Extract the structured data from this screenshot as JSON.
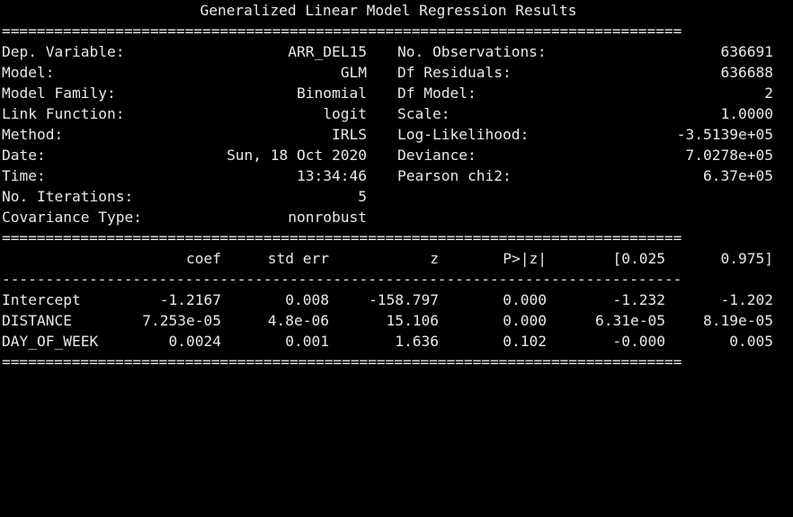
{
  "title": "Generalized Linear Model Regression Results",
  "rule_double": "==============================================================================",
  "rule_single": "------------------------------------------------------------------------------",
  "summary": {
    "left": [
      {
        "key": "Dep. Variable:",
        "value": "ARR_DEL15"
      },
      {
        "key": "Model:",
        "value": "GLM"
      },
      {
        "key": "Model Family:",
        "value": "Binomial"
      },
      {
        "key": "Link Function:",
        "value": "logit"
      },
      {
        "key": "Method:",
        "value": "IRLS"
      },
      {
        "key": "Date:",
        "value": "Sun, 18 Oct 2020"
      },
      {
        "key": "Time:",
        "value": "13:34:46"
      },
      {
        "key": "No. Iterations:",
        "value": "5"
      },
      {
        "key": "Covariance Type:",
        "value": "nonrobust"
      }
    ],
    "right": [
      {
        "key": "No. Observations:",
        "value": "636691"
      },
      {
        "key": "Df Residuals:",
        "value": "636688"
      },
      {
        "key": "Df Model:",
        "value": "2"
      },
      {
        "key": "Scale:",
        "value": "1.0000"
      },
      {
        "key": "Log-Likelihood:",
        "value": "-3.5139e+05"
      },
      {
        "key": "Deviance:",
        "value": "7.0278e+05"
      },
      {
        "key": "Pearson chi2:",
        "value": "6.37e+05"
      }
    ]
  },
  "coef_table": {
    "headers": [
      "",
      "coef",
      "std err",
      "z",
      "P>|z|",
      "[0.025",
      "0.975]"
    ],
    "rows": [
      [
        "Intercept",
        "-1.2167",
        "0.008",
        "-158.797",
        "0.000",
        "-1.232",
        "-1.202"
      ],
      [
        "DISTANCE",
        "7.253e-05",
        "4.8e-06",
        "15.106",
        "0.000",
        "6.31e-05",
        "8.19e-05"
      ],
      [
        "DAY_OF_WEEK",
        "0.0024",
        "0.001",
        "1.636",
        "0.102",
        "-0.000",
        "0.005"
      ]
    ]
  }
}
